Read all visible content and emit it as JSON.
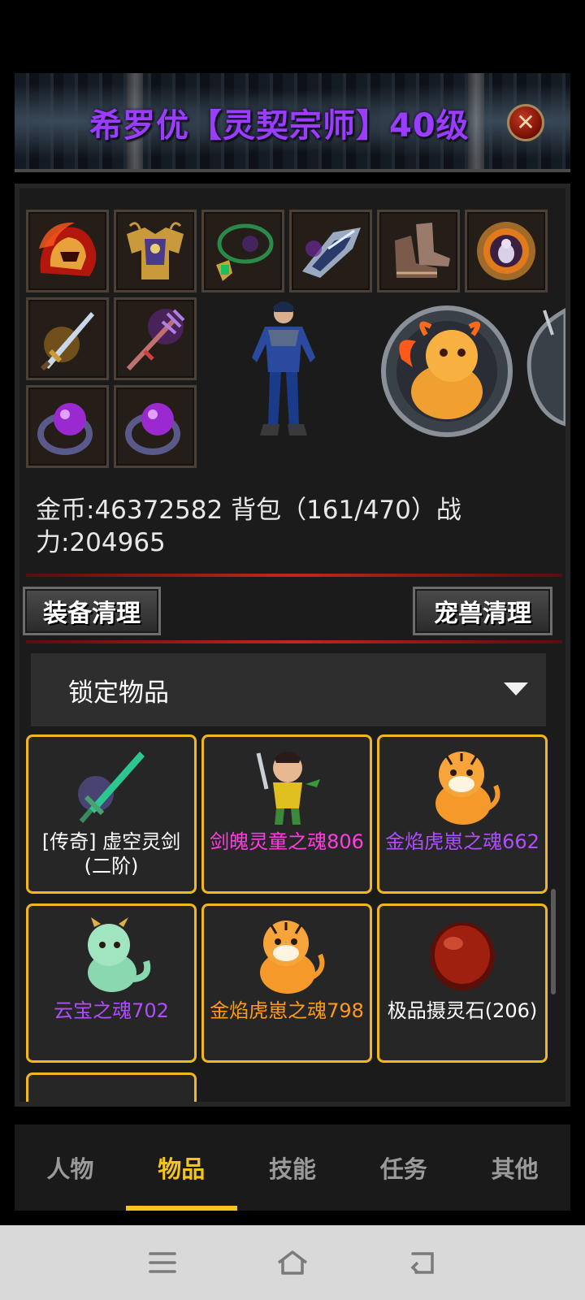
{
  "header": {
    "title": "希罗优【灵契宗师】40级",
    "close_icon": "close-icon"
  },
  "equipment": {
    "slots": [
      {
        "name": "helmet",
        "icon": "flame-helmet-icon"
      },
      {
        "name": "armor",
        "icon": "golden-armor-icon"
      },
      {
        "name": "necklace",
        "icon": "jade-necklace-icon"
      },
      {
        "name": "bracer",
        "icon": "silver-bracer-icon"
      },
      {
        "name": "boots",
        "icon": "leather-boots-icon"
      },
      {
        "name": "medal",
        "icon": "round-medal-icon"
      },
      {
        "name": "weapon",
        "icon": "golden-sword-icon"
      },
      {
        "name": "staff",
        "icon": "purple-trident-icon"
      },
      {
        "name": "ring-left",
        "icon": "purple-orb-ring-icon"
      },
      {
        "name": "ring-right",
        "icon": "purple-orb-ring-icon"
      }
    ],
    "character_icon": "armored-warrior-figure",
    "pet_icon": "golden-dragon-pet-medallion"
  },
  "stats": {
    "line": "金币:46372582 背包（161/470）战力:204965"
  },
  "actions": {
    "equip_cleanup": "装备清理",
    "pet_cleanup": "宠兽清理"
  },
  "filter": {
    "selected": "锁定物品",
    "arrow_icon": "triangle-down-icon"
  },
  "items": [
    {
      "name": "[传奇] 虚空灵剑 (二阶)",
      "color": "#ffffff",
      "icon": "jade-sword-icon"
    },
    {
      "name": "剑魄灵童之魂806",
      "color": "#ff3de0",
      "icon": "sword-child-icon"
    },
    {
      "name": "金焰虎崽之魂662",
      "color": "#b04dff",
      "icon": "tiger-cub-icon"
    },
    {
      "name": "云宝之魂702",
      "color": "#b04dff",
      "icon": "baby-dragon-icon"
    },
    {
      "name": "金焰虎崽之魂798",
      "color": "#ff9a1a",
      "icon": "tiger-cub-icon"
    },
    {
      "name": "极品摄灵石(206)",
      "color": "#ffffff",
      "icon": "red-spirit-stone-icon"
    }
  ],
  "tabs": [
    {
      "label": "人物",
      "active": false
    },
    {
      "label": "物品",
      "active": true
    },
    {
      "label": "技能",
      "active": false
    },
    {
      "label": "任务",
      "active": false
    },
    {
      "label": "其他",
      "active": false
    }
  ],
  "colors": {
    "title": "#9b3dff",
    "accent": "#f5c518",
    "card_border": "#f2b81b",
    "divider": "#c4261a"
  },
  "system_nav": {
    "menu_icon": "menu-icon",
    "home_icon": "home-icon",
    "back_icon": "back-icon"
  }
}
